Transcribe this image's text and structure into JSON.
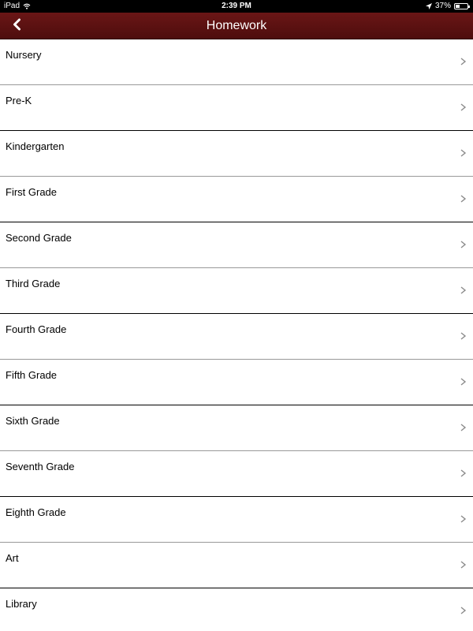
{
  "status_bar": {
    "device": "iPad",
    "time": "2:39 PM",
    "battery": "37%",
    "battery_level": 0.37,
    "icons": [
      "wifi-icon",
      "location-icon",
      "battery-icon"
    ]
  },
  "nav": {
    "title": "Homework",
    "back_icon": "chevron-left-icon",
    "bar_color": "#5c1111"
  },
  "list": {
    "items": [
      {
        "label": "Nursery"
      },
      {
        "label": "Pre-K"
      },
      {
        "label": "Kindergarten"
      },
      {
        "label": "First Grade"
      },
      {
        "label": "Second Grade"
      },
      {
        "label": "Third Grade"
      },
      {
        "label": "Fourth Grade"
      },
      {
        "label": "Fifth Grade"
      },
      {
        "label": "Sixth Grade"
      },
      {
        "label": "Seventh Grade"
      },
      {
        "label": "Eighth Grade"
      },
      {
        "label": "Art"
      },
      {
        "label": "Library"
      }
    ],
    "row_icon": "chevron-right-icon"
  }
}
